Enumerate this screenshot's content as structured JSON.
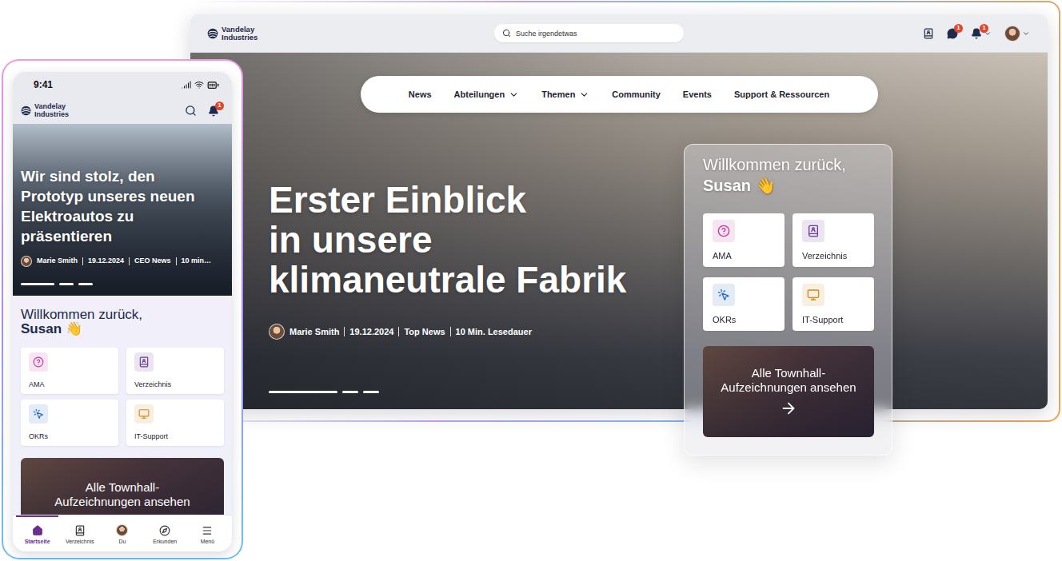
{
  "desktop": {
    "logo": {
      "line1": "Vandelay",
      "line2": "Industries"
    },
    "search": {
      "placeholder": "Suche irgendetwas"
    },
    "header": {
      "chat_badge": "1",
      "notification_badge": "1"
    },
    "nav": [
      {
        "label": "News",
        "kind": "link"
      },
      {
        "label": "Abteilungen",
        "kind": "dropdown"
      },
      {
        "label": "Themen",
        "kind": "dropdown"
      },
      {
        "label": "Community",
        "kind": "link"
      },
      {
        "label": "Events",
        "kind": "link"
      },
      {
        "label": "Support & Ressourcen",
        "kind": "link"
      }
    ],
    "hero": {
      "title_lines": [
        "Erster Einblick",
        "in unsere",
        "klimaneutrale Fabrik"
      ],
      "meta": [
        "Marie Smith",
        "19.12.2024",
        "Top News",
        "10 Min. Lesedauer"
      ],
      "slides": [
        {
          "selected": true
        },
        {
          "selected": false
        },
        {
          "selected": false
        }
      ]
    },
    "welcome": {
      "greeting": "Willkommen zurück,",
      "name": "Susan 👋",
      "tiles": [
        {
          "label": "AMA",
          "color": "#c23aa0"
        },
        {
          "label": "Verzeichnis",
          "color": "#6a3d9a"
        },
        {
          "label": "OKRs",
          "color": "#2b6cc4"
        },
        {
          "label": "IT-Support",
          "color": "#d4891f"
        }
      ],
      "banner": "Alle Townhall-Aufzeichnungen ansehen"
    }
  },
  "mobile": {
    "status_bar": {
      "time": "9:41"
    },
    "logo": {
      "line1": "Vandelay",
      "line2": "Industries"
    },
    "notification_badge": "1",
    "hero": {
      "title_lines": [
        "Wir sind stolz, den",
        "Prototyp unseres neuen",
        "Elektroautos zu",
        "präsentieren"
      ],
      "meta": [
        "Marie Smith",
        "19.12.2024",
        "CEO News",
        "10 min…"
      ],
      "slides": [
        {
          "selected": true
        },
        {
          "selected": false
        },
        {
          "selected": false
        }
      ]
    },
    "welcome": {
      "greeting": "Willkommen zurück,",
      "name": "Susan 👋",
      "tiles": [
        {
          "label": "AMA",
          "color": "#c23aa0"
        },
        {
          "label": "Verzeichnis",
          "color": "#6a3d9a"
        },
        {
          "label": "OKRs",
          "color": "#2b6cc4"
        },
        {
          "label": "IT-Support",
          "color": "#d4891f"
        }
      ],
      "banner": "Alle Townhall-Aufzeichnungen ansehen"
    },
    "bottom_nav": [
      {
        "label": "Startseite",
        "kind": "icon",
        "selected": true
      },
      {
        "label": "Verzeichnis",
        "kind": "icon",
        "selected": false
      },
      {
        "label": "Du",
        "kind": "avatar",
        "selected": false
      },
      {
        "label": "Erkunden",
        "kind": "icon",
        "selected": false
      },
      {
        "label": "Menü",
        "kind": "icon",
        "selected": false
      }
    ]
  }
}
